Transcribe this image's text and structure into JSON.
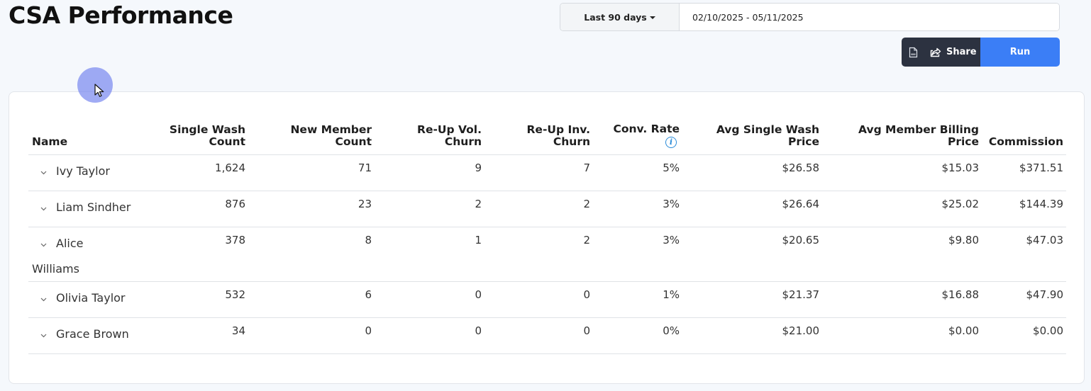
{
  "page": {
    "title": "CSA Performance"
  },
  "date_range": {
    "preset_label": "Last 90 days",
    "value": "02/10/2025 - 05/11/2025"
  },
  "actions": {
    "csv_icon": "csv-file-icon",
    "share_icon": "share-arrow-icon",
    "share_label": "Share",
    "run_label": "Run"
  },
  "colors": {
    "run": "#3b7ef6",
    "dark_button": "#2c3240",
    "info": "#2a8bd8"
  },
  "table": {
    "headers": {
      "name": "Name",
      "single_wash_1": "Single Wash",
      "single_wash_2": "Count",
      "new_member_1": "New Member",
      "new_member_2": "Count",
      "reup_vol_1": "Re-Up Vol.",
      "reup_vol_2": "Churn",
      "reup_inv_1": "Re-Up Inv.",
      "reup_inv_2": "Churn",
      "conv_rate": "Conv. Rate",
      "conv_rate_info": "i",
      "avg_single_1": "Avg Single Wash",
      "avg_single_2": "Price",
      "avg_member_1": "Avg Member Billing",
      "avg_member_2": "Price",
      "commission": "Commission"
    },
    "rows": [
      {
        "first": "Ivy Taylor",
        "second": "",
        "single_wash": "1,624",
        "new_member": "71",
        "reup_vol": "9",
        "reup_inv": "7",
        "conv_rate": "5%",
        "avg_single": "$26.58",
        "avg_member": "$15.03",
        "commission": "$371.51"
      },
      {
        "first": "Liam Sindher",
        "second": "",
        "single_wash": "876",
        "new_member": "23",
        "reup_vol": "2",
        "reup_inv": "2",
        "conv_rate": "3%",
        "avg_single": "$26.64",
        "avg_member": "$25.02",
        "commission": "$144.39"
      },
      {
        "first": "Alice",
        "second": "Williams",
        "single_wash": "378",
        "new_member": "8",
        "reup_vol": "1",
        "reup_inv": "2",
        "conv_rate": "3%",
        "avg_single": "$20.65",
        "avg_member": "$9.80",
        "commission": "$47.03"
      },
      {
        "first": "Olivia Taylor",
        "second": "",
        "single_wash": "532",
        "new_member": "6",
        "reup_vol": "0",
        "reup_inv": "0",
        "conv_rate": "1%",
        "avg_single": "$21.37",
        "avg_member": "$16.88",
        "commission": "$47.90"
      },
      {
        "first": "Grace Brown",
        "second": "",
        "single_wash": "34",
        "new_member": "0",
        "reup_vol": "0",
        "reup_inv": "0",
        "conv_rate": "0%",
        "avg_single": "$21.00",
        "avg_member": "$0.00",
        "commission": "$0.00"
      }
    ]
  }
}
